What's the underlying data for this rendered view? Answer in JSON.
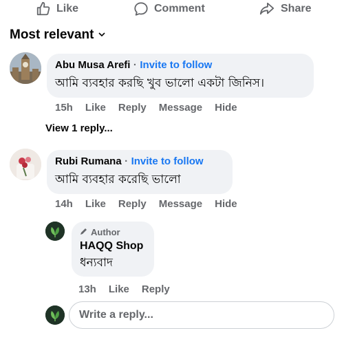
{
  "actions": {
    "like": "Like",
    "comment": "Comment",
    "share": "Share"
  },
  "sort": {
    "label": "Most relevant"
  },
  "comments": [
    {
      "name": "Abu Musa Arefi",
      "separator": "·",
      "invite": "Invite to follow",
      "text": "আমি ব্যবহার করছি খুব ভালো একটা জিনিস।",
      "time": "15h",
      "like": "Like",
      "reply": "Reply",
      "message": "Message",
      "hide": "Hide"
    },
    {
      "name": "Rubi Rumana",
      "separator": "·",
      "invite": "Invite to follow",
      "text": "আমি ব্যবহার করেছি ভালো",
      "time": "14h",
      "like": "Like",
      "reply": "Reply",
      "message": "Message",
      "hide": "Hide"
    }
  ],
  "view_replies": "View 1 reply...",
  "reply": {
    "badge": "Author",
    "name": "HAQQ Shop",
    "text": "ধন্যবাদ",
    "time": "13h",
    "like": "Like",
    "reply": "Reply"
  },
  "reply_input": {
    "placeholder": "Write a reply..."
  },
  "colors": {
    "accent": "#1877f2",
    "bubble": "#f0f2f5",
    "muted": "#65676b"
  }
}
